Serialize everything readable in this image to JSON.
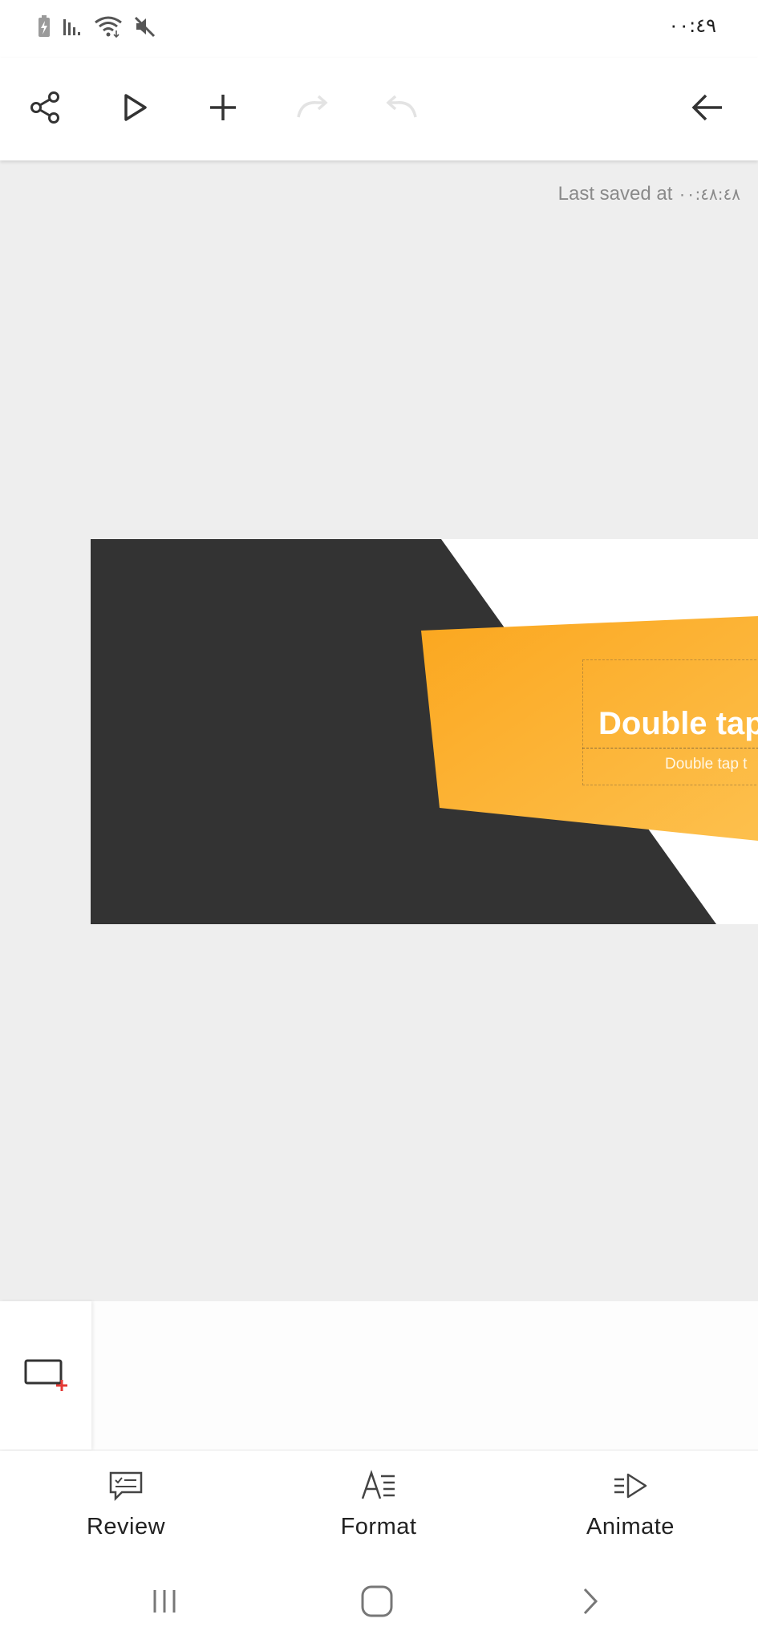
{
  "status_bar": {
    "time": "٠٠:٤٩",
    "icons": [
      "battery-charging-icon",
      "signal-icon",
      "wifi-icon",
      "mute-icon"
    ]
  },
  "toolbar": {
    "icons": [
      "share-icon",
      "play-icon",
      "add-icon",
      "redo-icon",
      "undo-icon",
      "back-arrow-icon"
    ]
  },
  "document": {
    "last_saved_label": "Last saved at",
    "last_saved_time": "٠٠:٤٨:٤٨"
  },
  "slide": {
    "title_placeholder": "Double tap",
    "subtitle_placeholder": "Double tap t",
    "colors": {
      "dark": "#333333",
      "orange_start": "#fba71f",
      "orange_end": "#fdc04d",
      "light": "#ffffff"
    }
  },
  "thumbnail_strip": {
    "add_slide_icon": "add-slide-icon"
  },
  "bottom_tabs": [
    {
      "label": "Review",
      "icon": "review-icon"
    },
    {
      "label": "Format",
      "icon": "format-icon"
    },
    {
      "label": "Animate",
      "icon": "animate-icon"
    }
  ],
  "navigation": {
    "icons": [
      "recent-apps-icon",
      "home-icon",
      "back-icon"
    ]
  }
}
